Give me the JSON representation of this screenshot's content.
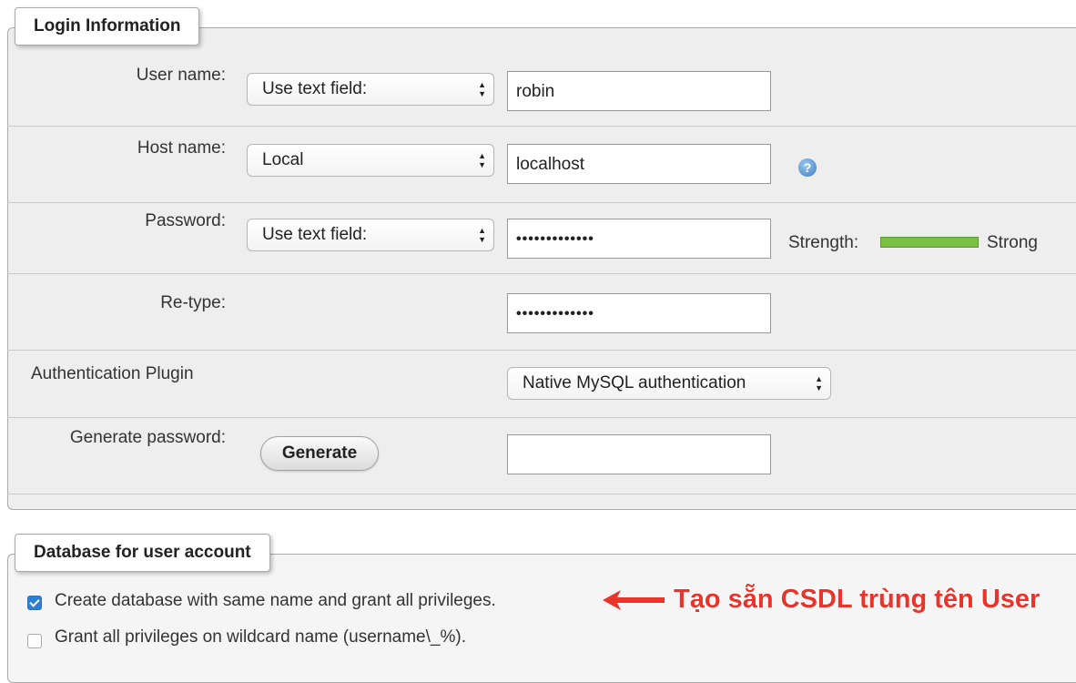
{
  "login": {
    "legend": "Login Information",
    "username": {
      "label": "User name:",
      "mode": "Use text field:",
      "value": "robin"
    },
    "hostname": {
      "label": "Host name:",
      "mode": "Local",
      "value": "localhost",
      "help_icon": "help-icon"
    },
    "password": {
      "label": "Password:",
      "mode": "Use text field:",
      "value": "•••••••••••••",
      "strength_label": "Strength:",
      "strength_text": "Strong",
      "strength_color": "#7ac143"
    },
    "retype": {
      "label": "Re-type:",
      "value": "•••••••••••••"
    },
    "auth_plugin": {
      "label": "Authentication Plugin",
      "value": "Native MySQL authentication"
    },
    "generate": {
      "label": "Generate password:",
      "button": "Generate",
      "value": ""
    }
  },
  "database": {
    "legend": "Database for user account",
    "create_same_name": {
      "label": "Create database with same name and grant all privileges.",
      "checked": true
    },
    "grant_wildcard": {
      "label": "Grant all privileges on wildcard name (username\\_%).",
      "checked": false
    }
  },
  "annotation": {
    "text": "Tạo sẵn CSDL trùng tên User",
    "color": "#e8342a"
  }
}
